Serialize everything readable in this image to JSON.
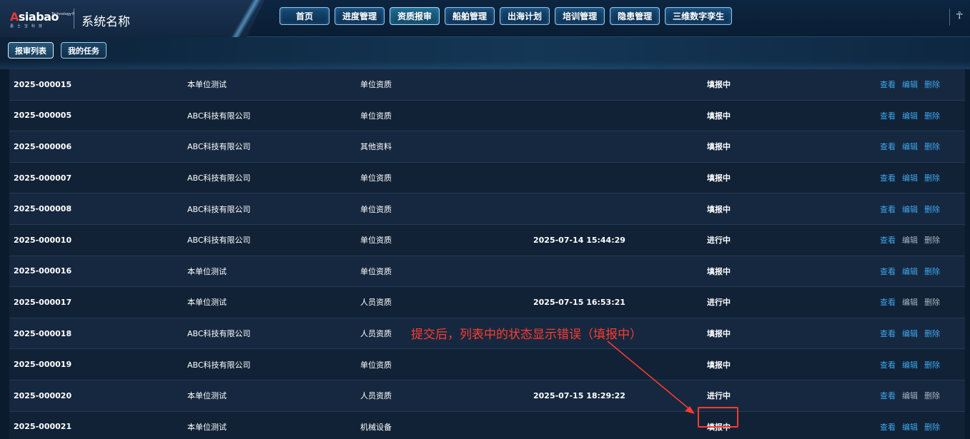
{
  "brand": {
    "logo_tech": "Technology®",
    "logo_main_a": "A",
    "logo_main_rest": "siabao",
    "logo_sub": "嘉士宝科技",
    "system_name": "系统名称"
  },
  "nav": {
    "items": [
      {
        "label": "首页"
      },
      {
        "label": "进度管理"
      },
      {
        "label": "资质报审"
      },
      {
        "label": "船舶管理"
      },
      {
        "label": "出海计划"
      },
      {
        "label": "培训管理"
      },
      {
        "label": "隐患管理"
      },
      {
        "label": "三维数字孪生"
      }
    ],
    "active": "资质报审"
  },
  "subtabs": [
    {
      "label": "报审列表"
    },
    {
      "label": "我的任务"
    }
  ],
  "table": {
    "rows": [
      {
        "id": "2025-000015",
        "unit": "本单位测试",
        "type": "单位资质",
        "time": "",
        "status": "填报中",
        "actions": [
          "查看",
          "编辑",
          "删除"
        ],
        "editable": true
      },
      {
        "id": "2025-000005",
        "unit": "ABC科技有限公司",
        "type": "单位资质",
        "time": "",
        "status": "填报中",
        "actions": [
          "查看",
          "编辑",
          "删除"
        ],
        "editable": true
      },
      {
        "id": "2025-000006",
        "unit": "ABC科技有限公司",
        "type": "其他资料",
        "time": "",
        "status": "填报中",
        "actions": [
          "查看",
          "编辑",
          "删除"
        ],
        "editable": true
      },
      {
        "id": "2025-000007",
        "unit": "ABC科技有限公司",
        "type": "单位资质",
        "time": "",
        "status": "填报中",
        "actions": [
          "查看",
          "编辑",
          "删除"
        ],
        "editable": true
      },
      {
        "id": "2025-000008",
        "unit": "ABC科技有限公司",
        "type": "单位资质",
        "time": "",
        "status": "填报中",
        "actions": [
          "查看",
          "编辑",
          "删除"
        ],
        "editable": true
      },
      {
        "id": "2025-000010",
        "unit": "ABC科技有限公司",
        "type": "单位资质",
        "time": "2025-07-14 15:44:29",
        "status": "进行中",
        "actions": [
          "查看",
          "编辑",
          "删除"
        ],
        "editable": false
      },
      {
        "id": "2025-000016",
        "unit": "本单位测试",
        "type": "单位资质",
        "time": "",
        "status": "填报中",
        "actions": [
          "查看",
          "编辑",
          "删除"
        ],
        "editable": true
      },
      {
        "id": "2025-000017",
        "unit": "本单位测试",
        "type": "人员资质",
        "time": "2025-07-15 16:53:21",
        "status": "进行中",
        "actions": [
          "查看",
          "编辑",
          "删除"
        ],
        "editable": false
      },
      {
        "id": "2025-000018",
        "unit": "ABC科技有限公司",
        "type": "人员资质",
        "time": "",
        "status": "填报中",
        "actions": [
          "查看",
          "编辑",
          "删除"
        ],
        "editable": true
      },
      {
        "id": "2025-000019",
        "unit": "ABC科技有限公司",
        "type": "单位资质",
        "time": "",
        "status": "填报中",
        "actions": [
          "查看",
          "编辑",
          "删除"
        ],
        "editable": true
      },
      {
        "id": "2025-000020",
        "unit": "本单位测试",
        "type": "人员资质",
        "time": "2025-07-15 18:29:22",
        "status": "进行中",
        "actions": [
          "查看",
          "编辑",
          "删除"
        ],
        "editable": false
      },
      {
        "id": "2025-000021",
        "unit": "本单位测试",
        "type": "机械设备",
        "time": "",
        "status": "填报中",
        "actions": [
          "查看",
          "编辑",
          "删除"
        ],
        "editable": true
      }
    ]
  },
  "annotation": {
    "text": "提交后，列表中的状态显示错误（填报中）",
    "color": "#ff3b30"
  },
  "colors": {
    "action_enabled": "#3ea6ee",
    "action_disabled": "#a7b3c0"
  }
}
